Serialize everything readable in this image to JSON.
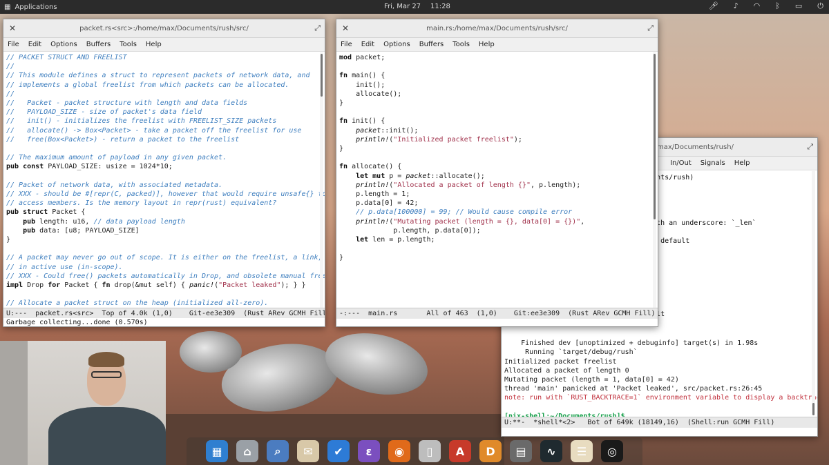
{
  "colors": {
    "comment": "#3f7fbf",
    "string": "#a0304a",
    "error": "#c0303c",
    "prompt": "#16a04a"
  },
  "top_panel": {
    "apps_label": "Applications",
    "date": "Fri, Mar 27",
    "time": "11:28"
  },
  "win_packet": {
    "title": "packet.rs<src>:/home/max/Documents/rush/src/",
    "menu": [
      "File",
      "Edit",
      "Options",
      "Buffers",
      "Tools",
      "Help"
    ],
    "lines": [
      [
        [
          "c-cm",
          "// PACKET STRUCT AND FREELIST"
        ]
      ],
      [
        [
          "c-cm",
          "//"
        ]
      ],
      [
        [
          "c-cm",
          "// This module defines a struct to represent packets of network data, and"
        ]
      ],
      [
        [
          "c-cm",
          "// implements a global freelist from which packets can be allocated."
        ]
      ],
      [
        [
          "c-cm",
          "//"
        ]
      ],
      [
        [
          "c-cm",
          "//   Packet - packet structure with length and data fields"
        ]
      ],
      [
        [
          "c-cm",
          "//   PAYLOAD_SIZE - size of packet's data field"
        ]
      ],
      [
        [
          "c-cm",
          "//   init() - initializes the freelist with FREELIST_SIZE packets"
        ]
      ],
      [
        [
          "c-cm",
          "//   allocate() -> Box<Packet> - take a packet off the freelist for use"
        ]
      ],
      [
        [
          "c-cm",
          "//   free(Box<Packet>) - return a packet to the freelist"
        ]
      ],
      [
        [
          "",
          ""
        ]
      ],
      [
        [
          "c-cm",
          "// The maximum amount of payload in any given packet."
        ]
      ],
      [
        [
          "c-kw",
          "pub const"
        ],
        [
          "c-ty",
          " PAYLOAD_SIZE: usize = 1024*10;"
        ]
      ],
      [
        [
          "",
          ""
        ]
      ],
      [
        [
          "c-cm",
          "// Packet of network data, with associated metadata."
        ]
      ],
      [
        [
          "c-cm",
          "// XXX - should be #[repr(C, packed)], however that would require unsafe{} to"
        ]
      ],
      [
        [
          "c-cm",
          "// access members. Is the memory layout in repr(rust) equivalent?"
        ]
      ],
      [
        [
          "c-kw",
          "pub struct"
        ],
        [
          "c-ty",
          " Packet {"
        ]
      ],
      [
        [
          "c-kw",
          "    pub"
        ],
        [
          "c-ty",
          " length: u16, "
        ],
        [
          "c-cm",
          "// data payload length"
        ]
      ],
      [
        [
          "c-kw",
          "    pub"
        ],
        [
          "c-ty",
          " data: [u8; PAYLOAD_SIZE]"
        ]
      ],
      [
        [
          "c-ty",
          "}"
        ]
      ],
      [
        [
          "",
          ""
        ]
      ],
      [
        [
          "c-cm",
          "// A packet may never go out of scope. It is either on the freelist, a link, or"
        ]
      ],
      [
        [
          "c-cm",
          "// in active use (in-scope)."
        ]
      ],
      [
        [
          "c-cm",
          "// XXX - Could free() packets automatically in Drop, and obsolete manual free."
        ]
      ],
      [
        [
          "c-kw",
          "impl"
        ],
        [
          "c-ty",
          " Drop "
        ],
        [
          "c-kw",
          "for"
        ],
        [
          "c-ty",
          " Packet { "
        ],
        [
          "c-kw",
          "fn"
        ],
        [
          "c-ty",
          " drop(&mut self) { "
        ],
        [
          "c-mac",
          "panic!"
        ],
        [
          "c-ty",
          "("
        ],
        [
          "c-str",
          "\"Packet leaked\""
        ],
        [
          "c-ty",
          "); } }"
        ]
      ],
      [
        [
          "",
          ""
        ]
      ],
      [
        [
          "c-cm",
          "// Allocate a packet struct on the heap (initialized all-zero)."
        ]
      ]
    ],
    "modeline": "U:---  packet.rs<src>  Top of 4.0k (1,0)    Git-ee3e309  (Rust ARev GCMH Fill)",
    "minibuffer": "Garbage collecting...done (0.570s)"
  },
  "win_main": {
    "title": "main.rs:/home/max/Documents/rush/src/",
    "menu": [
      "File",
      "Edit",
      "Options",
      "Buffers",
      "Tools",
      "Help"
    ],
    "lines": [
      [
        [
          "c-kw",
          "mod"
        ],
        [
          "c-ty",
          " packet;"
        ]
      ],
      [
        [
          "",
          ""
        ]
      ],
      [
        [
          "c-kw",
          "fn"
        ],
        [
          "c-ty",
          " main() {"
        ]
      ],
      [
        [
          "c-ty",
          "    init();"
        ]
      ],
      [
        [
          "c-ty",
          "    allocate();"
        ]
      ],
      [
        [
          "c-ty",
          "}"
        ]
      ],
      [
        [
          "",
          ""
        ]
      ],
      [
        [
          "c-kw",
          "fn"
        ],
        [
          "c-ty",
          " init() {"
        ]
      ],
      [
        [
          "c-ty",
          "    "
        ],
        [
          "c-mac",
          "packet"
        ],
        [
          "c-ty",
          "::init();"
        ]
      ],
      [
        [
          "c-ty",
          "    "
        ],
        [
          "c-mac",
          "println!"
        ],
        [
          "c-ty",
          "("
        ],
        [
          "c-str",
          "\"Initialized packet freelist\""
        ],
        [
          "c-ty",
          ");"
        ]
      ],
      [
        [
          "c-ty",
          "}"
        ]
      ],
      [
        [
          "",
          ""
        ]
      ],
      [
        [
          "c-kw",
          "fn"
        ],
        [
          "c-ty",
          " allocate() {"
        ]
      ],
      [
        [
          "c-kw",
          "    let mut"
        ],
        [
          "c-ty",
          " p = "
        ],
        [
          "c-mac",
          "packet"
        ],
        [
          "c-ty",
          "::allocate();"
        ]
      ],
      [
        [
          "c-ty",
          "    "
        ],
        [
          "c-mac",
          "println!"
        ],
        [
          "c-ty",
          "("
        ],
        [
          "c-str",
          "\"Allocated a packet of length {}\""
        ],
        [
          "c-ty",
          ", p.length);"
        ]
      ],
      [
        [
          "c-ty",
          "    p.length = 1;"
        ]
      ],
      [
        [
          "c-ty",
          "    p.data[0] = 42;"
        ]
      ],
      [
        [
          "c-cm",
          "    // p.data[100000] = 99; // Would cause compile error"
        ]
      ],
      [
        [
          "c-ty",
          "    "
        ],
        [
          "c-mac",
          "println!"
        ],
        [
          "c-ty",
          "("
        ],
        [
          "c-str",
          "\"Mutating packet (length = {}, data[0] = {})\""
        ],
        [
          "c-ty",
          ","
        ]
      ],
      [
        [
          "c-ty",
          "             p.length, p.data[0]);"
        ]
      ],
      [
        [
          "c-kw",
          "    let"
        ],
        [
          "c-ty",
          " len = p.length;"
        ]
      ],
      [
        [
          "",
          ""
        ]
      ],
      [
        [
          "c-ty",
          "}"
        ]
      ]
    ],
    "modeline": "-:---  main.rs       All of 463  (1,0)    Git:ee3e309  (Rust ARev GCMH Fill)"
  },
  "win_shell": {
    "title": "max/Documents/rush/",
    "menu": [
      "In/Out",
      "Signals",
      "Help"
    ],
    "top_lines": [
      "cuments/rush)",
      "",
      "",
      "",
      "",
      "g with an underscore: `_len`",
      "",
      "n by default",
      "",
      "",
      "",
      "",
      "",
      "",
      "",
      "efault"
    ],
    "bottom_lines": [
      [
        [
          "",
          ""
        ]
      ],
      [
        [
          "c-ty",
          "    Finished dev [unoptimized + debuginfo] target(s) in 1.98s"
        ]
      ],
      [
        [
          "c-ty",
          "     Running `target/debug/rush`"
        ]
      ],
      [
        [
          "c-ty",
          "Initialized packet freelist"
        ]
      ],
      [
        [
          "c-ty",
          "Allocated a packet of length 0"
        ]
      ],
      [
        [
          "c-ty",
          "Mutating packet (length = 1, data[0] = 42)"
        ]
      ],
      [
        [
          "c-ty",
          "thread 'main' panicked at 'Packet leaked', src/packet.rs:26:45"
        ]
      ],
      [
        [
          "c-err",
          "note: run with `RUST_BACKTRACE=1` environment variable to display a backtrace"
        ]
      ],
      [
        [
          "",
          ""
        ]
      ],
      [
        [
          "c-green",
          "[nix-shell:~/Documents/rush]$"
        ]
      ]
    ],
    "modeline": "U:**-  *shell*<2>   Bot of 649k (18149,16)  (Shell:run GCMH Fill)"
  },
  "dock": {
    "icons": [
      {
        "name": "multitasking-view-icon",
        "glyph": "▦",
        "color": "#2f7fd0"
      },
      {
        "name": "files-icon",
        "glyph": "⌂",
        "color": "#9aa0a6"
      },
      {
        "name": "search-magnifier-icon",
        "glyph": "⌕",
        "color": "#4b7cc0"
      },
      {
        "name": "mail-icon",
        "glyph": "✉",
        "color": "#d8c8a8"
      },
      {
        "name": "tasks-check-icon",
        "glyph": "✔",
        "color": "#2d7bd6"
      },
      {
        "name": "emacs-icon",
        "glyph": "ε",
        "color": "#7b4fbf"
      },
      {
        "name": "firefox-icon",
        "glyph": "◉",
        "color": "#e06a1a"
      },
      {
        "name": "ipod-icon",
        "glyph": "▯",
        "color": "#bdbdbd"
      },
      {
        "name": "text-editor-a-icon",
        "glyph": "A",
        "color": "#c73a2a"
      },
      {
        "name": "document-d-icon",
        "glyph": "D",
        "color": "#e08a2a"
      },
      {
        "name": "calculator-icon",
        "glyph": "▤",
        "color": "#6a6a6a"
      },
      {
        "name": "system-monitor-icon",
        "glyph": "∿",
        "color": "#1f2a2f"
      },
      {
        "name": "notes-clipboard-icon",
        "glyph": "☰",
        "color": "#e8dcc0"
      },
      {
        "name": "obs-studio-icon",
        "glyph": "◎",
        "color": "#1a1a1a"
      }
    ]
  }
}
